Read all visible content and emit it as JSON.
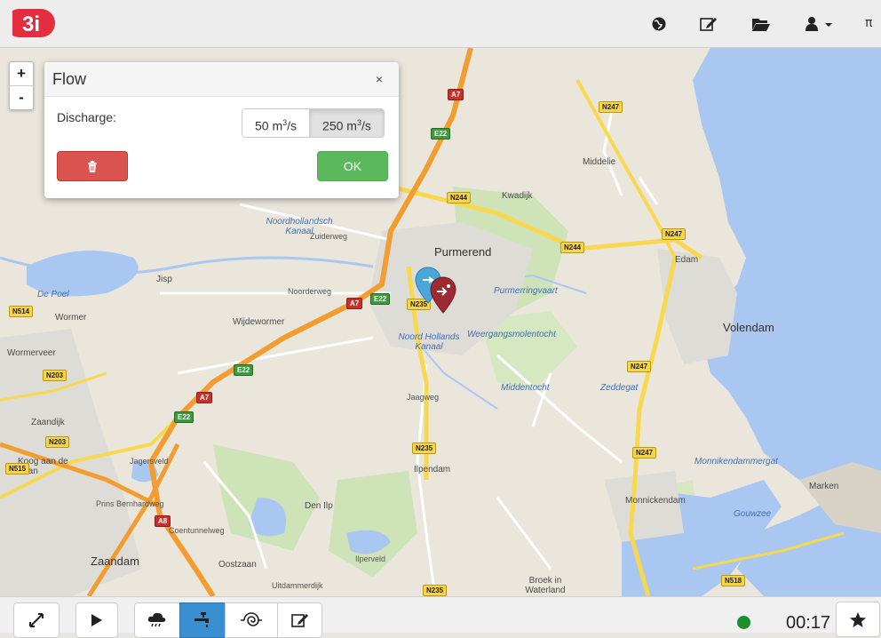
{
  "app": {
    "logo_text": "3i",
    "pi_label": "π"
  },
  "nav_icons": [
    "globe-icon",
    "edit-icon",
    "folder-open-icon",
    "user-icon"
  ],
  "flow_panel": {
    "title": "Flow",
    "close_label": "×",
    "discharge_label": "Discharge:",
    "options": [
      {
        "value": "50 m",
        "unit_sup": "3",
        "suffix": "/s",
        "selected": false
      },
      {
        "value": "250 m",
        "unit_sup": "3",
        "suffix": "/s",
        "selected": true
      }
    ],
    "ok_label": "OK",
    "delete_icon": "trash-icon"
  },
  "zoom": {
    "in_label": "+",
    "out_label": "-"
  },
  "map": {
    "labels": [
      {
        "text": "Purmerend",
        "cls": "big"
      },
      {
        "text": "Volendam",
        "cls": "big"
      },
      {
        "text": "Zaandam",
        "cls": "big"
      },
      {
        "text": "Monnickendam",
        "cls": ""
      },
      {
        "text": "Edam",
        "cls": ""
      },
      {
        "text": "Wormer",
        "cls": ""
      },
      {
        "text": "Wormerveer",
        "cls": ""
      },
      {
        "text": "Koog aan de Zaan",
        "cls": ""
      },
      {
        "text": "Zaandijk",
        "cls": ""
      },
      {
        "text": "Middelie",
        "cls": ""
      },
      {
        "text": "Kwadijk",
        "cls": ""
      },
      {
        "text": "Ilpendam",
        "cls": ""
      },
      {
        "text": "Den Ilp",
        "cls": ""
      },
      {
        "text": "Broek in Waterland",
        "cls": ""
      },
      {
        "text": "Marken",
        "cls": ""
      },
      {
        "text": "Jisp",
        "cls": ""
      },
      {
        "text": "Wijdewormer",
        "cls": ""
      },
      {
        "text": "Oostzaan",
        "cls": ""
      },
      {
        "text": "Monnikendammergat",
        "cls": "water"
      },
      {
        "text": "Gouwzee",
        "cls": "water"
      },
      {
        "text": "Purmerringvaart",
        "cls": "water"
      },
      {
        "text": "Weergangsmolentocht",
        "cls": "water"
      },
      {
        "text": "Noord Hollands Kanaal",
        "cls": "water"
      },
      {
        "text": "Noordhollandsch Kanaal",
        "cls": "water"
      },
      {
        "text": "De Poel",
        "cls": "water"
      },
      {
        "text": "Zuiderweg",
        "cls": "road"
      },
      {
        "text": "Noorderweg",
        "cls": "road"
      },
      {
        "text": "Jagersveld",
        "cls": "road"
      },
      {
        "text": "Prins Bernhardweg",
        "cls": "road"
      },
      {
        "text": "Coentunnelweg",
        "cls": "road"
      },
      {
        "text": "Jaagweg",
        "cls": "road"
      },
      {
        "text": "Middentocht",
        "cls": "water"
      },
      {
        "text": "Zeddegat",
        "cls": "water"
      },
      {
        "text": "Ilperveld",
        "cls": "road"
      },
      {
        "text": "Uitdammerdijk",
        "cls": "road"
      }
    ],
    "shields": [
      {
        "text": "A7",
        "cls": "r"
      },
      {
        "text": "A7",
        "cls": "r"
      },
      {
        "text": "A7",
        "cls": "r"
      },
      {
        "text": "A8",
        "cls": "r"
      },
      {
        "text": "E22",
        "cls": "g"
      },
      {
        "text": "E22",
        "cls": "g"
      },
      {
        "text": "E22",
        "cls": "g"
      },
      {
        "text": "E22",
        "cls": "g"
      },
      {
        "text": "N244",
        "cls": "y"
      },
      {
        "text": "N244",
        "cls": "y"
      },
      {
        "text": "N247",
        "cls": "y"
      },
      {
        "text": "N247",
        "cls": "y"
      },
      {
        "text": "N247",
        "cls": "y"
      },
      {
        "text": "N247",
        "cls": "y"
      },
      {
        "text": "N235",
        "cls": "y"
      },
      {
        "text": "N235",
        "cls": "y"
      },
      {
        "text": "N235",
        "cls": "y"
      },
      {
        "text": "N203",
        "cls": "y"
      },
      {
        "text": "N203",
        "cls": "y"
      },
      {
        "text": "N514",
        "cls": "y"
      },
      {
        "text": "N515",
        "cls": "y"
      },
      {
        "text": "N518",
        "cls": "y"
      }
    ],
    "markers": [
      "flow-marker-blue",
      "flow-marker-red"
    ]
  },
  "bottom": {
    "tools": [
      "resize-icon",
      "play-icon",
      "rain-icon",
      "tap-icon",
      "wind-icon",
      "edit-icon"
    ],
    "active_tool": "tap-icon",
    "timer": "00:17",
    "status_color": "#1a8f2a",
    "favorite_icon": "star-icon"
  },
  "colors": {
    "accent": "#3a8fd1",
    "logo": "#e42d3f",
    "danger": "#d9534f",
    "success": "#5cb85c"
  }
}
